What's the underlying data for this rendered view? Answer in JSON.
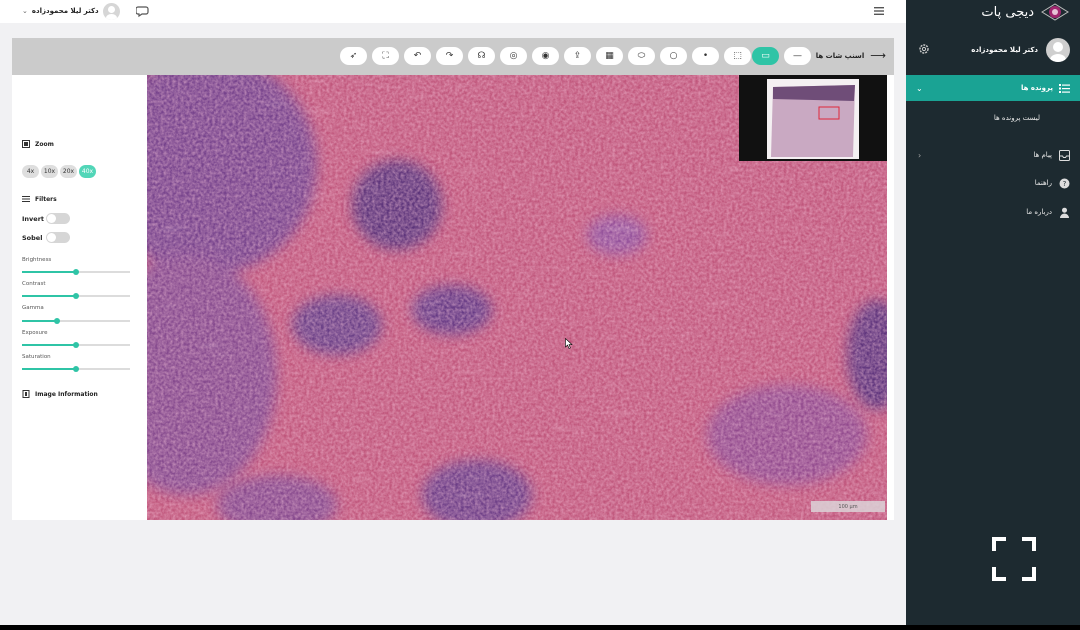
{
  "topbar": {
    "user_name": "دکتر لیلا محمودزاده",
    "icons": [
      "chevron-down-icon",
      "avatar",
      "chat-icon",
      "hamburger-icon"
    ]
  },
  "sidebar": {
    "brand": "دیجی پات",
    "user_name": "دکتر لیلا محمودزاده",
    "active_item": "پرونده ها",
    "active_sub": "لیست پرونده ها",
    "items": [
      {
        "label": "پیام ها",
        "icon": "inbox-icon"
      },
      {
        "label": "راهنما",
        "icon": "help-icon"
      },
      {
        "label": "درباره ما",
        "icon": "user-icon"
      }
    ],
    "accent": "#1aa394",
    "bg": "#1d2a30"
  },
  "toolbar": {
    "label": "اسنپ شات ها",
    "tools": [
      "pointer-icon",
      "fit-icon",
      "undo-icon",
      "redo-icon",
      "headset-icon",
      "annotate-icon",
      "hide-icon",
      "export-icon",
      "grid-icon",
      "ellipse-icon",
      "circle-icon",
      "point-icon",
      "rect-icon",
      "rect-active-icon",
      "line-icon"
    ],
    "active_color": "#2fc4a6"
  },
  "panel": {
    "zoom_title": "Zoom",
    "zoom_levels": [
      "4x",
      "10x",
      "20x",
      "40x"
    ],
    "zoom_active": "40x",
    "filters_title": "Filters",
    "invert_label": "Invert",
    "sobel_label": "Sobel",
    "sliders": [
      {
        "label": "Brightness",
        "value": 0.5
      },
      {
        "label": "Contrast",
        "value": 0.5
      },
      {
        "label": "Gamma",
        "value": 0.32
      },
      {
        "label": "Exposure",
        "value": 0.5
      },
      {
        "label": "Saturation",
        "value": 0.5
      }
    ],
    "info_title": "Image Information"
  },
  "viewer": {
    "scale_text": "100 µm"
  }
}
